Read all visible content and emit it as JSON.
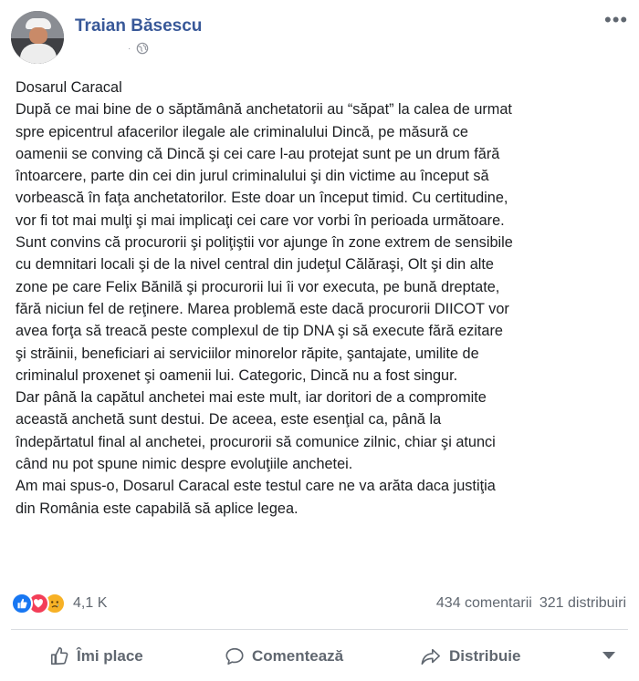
{
  "post": {
    "author": "Traian Băsescu",
    "meta_separator": "·",
    "privacy_icon": "globe-icon",
    "more_icon": "more-options-icon",
    "lines": [
      "Dosarul Caracal",
      "După ce mai bine de o săptămână anchetatorii au “săpat” la calea de urmat",
      "spre epicentrul afacerilor ilegale ale criminalului Dincă, pe măsură ce",
      "oamenii se conving că Dincă şi cei care l-au protejat sunt pe un drum fără",
      "întoarcere, parte din cei din jurul criminalului şi din victime au început să",
      "vorbească în faţa anchetatorilor. Este doar un început timid. Cu certitudine,",
      "vor fi tot mai mulţi şi mai implicaţi cei care vor vorbi în perioada următoare.",
      "Sunt convins că procurorii şi poliţiştii vor ajunge în zone extrem de sensibile",
      "cu demnitari locali şi de la nivel central din judeţul Călăraşi, Olt şi din alte",
      "zone pe care Felix Bănilă şi procurorii lui îi vor executa, pe bună dreptate,",
      "fără niciun fel de reţinere. Marea problemă este dacă procurorii DIICOT vor",
      "avea forţa să treacă peste complexul de tip DNA şi să execute fără ezitare",
      "şi străinii, beneficiari ai serviciilor minorelor răpite, şantajate, umilite de",
      "criminalul proxenet şi oamenii lui. Categoric, Dincă nu a fost singur.",
      "Dar până la capătul anchetei mai este mult, iar doritori de a compromite",
      "această anchetă sunt destui. De aceea, este esenţial ca, până la",
      "îndepărtatul final al anchetei, procurorii să comunice zilnic, chiar şi atunci",
      "când nu pot spune nimic despre evoluţiile anchetei.",
      "Am mai spus-o, Dosarul Caracal este testul care ne va arăta daca justiţia",
      "din România este capabilă să aplice legea."
    ]
  },
  "reactions": {
    "icons": [
      "like-reaction-icon",
      "love-reaction-icon",
      "sad-reaction-icon"
    ],
    "count": "4,1 K"
  },
  "stats": {
    "comments": "434 comentarii",
    "shares": "321 distribuiri"
  },
  "actions": {
    "like_label": "Îmi place",
    "comment_label": "Comentează",
    "share_label": "Distribuie"
  },
  "colors": {
    "author": "#385898",
    "secondary_text": "#606770",
    "like_blue": "#1877f2",
    "love_red": "#f33e58",
    "sad_yellow": "#f7b125"
  }
}
